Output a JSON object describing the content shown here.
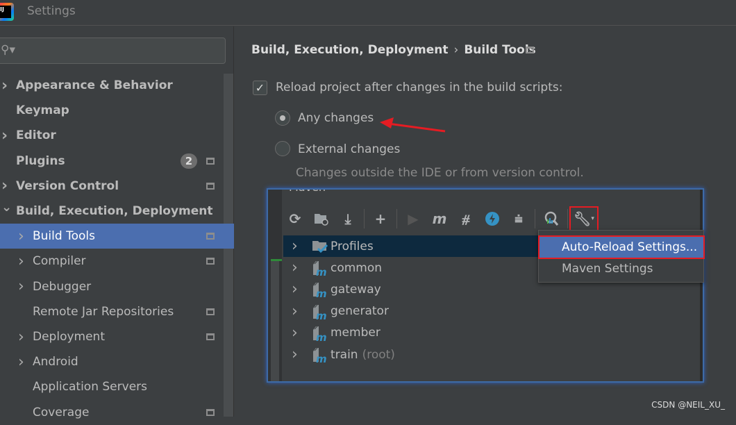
{
  "window": {
    "title": "Settings",
    "logo_text": "IJ"
  },
  "search": {
    "placeholder": ""
  },
  "sidebar": {
    "items": [
      {
        "label": "Appearance & Behavior",
        "expandable": true,
        "bold": true
      },
      {
        "label": "Keymap",
        "bold": true
      },
      {
        "label": "Editor",
        "expandable": true,
        "bold": true
      },
      {
        "label": "Plugins",
        "bold": true,
        "badge": "2"
      },
      {
        "label": "Version Control",
        "expandable": true,
        "bold": true
      },
      {
        "label": "Build, Execution, Deployment",
        "expanded": true,
        "bold": true
      },
      {
        "label": "Build Tools",
        "expandable": true,
        "selected": true
      },
      {
        "label": "Compiler",
        "expandable": true
      },
      {
        "label": "Debugger",
        "expandable": true
      },
      {
        "label": "Remote Jar Repositories"
      },
      {
        "label": "Deployment",
        "expandable": true
      },
      {
        "label": "Android",
        "expandable": true
      },
      {
        "label": "Application Servers"
      },
      {
        "label": "Coverage"
      }
    ]
  },
  "breadcrumb": {
    "parent": "Build, Execution, Deployment",
    "separator": "›",
    "current": "Build Tools"
  },
  "settings": {
    "reload_checkbox": {
      "label": "Reload project after changes in the build scripts:",
      "checked": true
    },
    "radio_any": {
      "label": "Any changes",
      "selected": true
    },
    "radio_external": {
      "label": "External changes",
      "selected": false
    },
    "external_hint": "Changes outside the IDE or from version control."
  },
  "maven": {
    "title": "Maven",
    "toolbar": [
      "refresh-icon",
      "folder-refresh-icon",
      "download-icon",
      "add-icon",
      "run-icon",
      "maven-goal-icon",
      "toggle-offline-icon",
      "lightning-icon",
      "collapse-icon",
      "analyze-icon",
      "wrench-icon"
    ],
    "tree": [
      {
        "name": "Profiles",
        "icon": "profiles-icon",
        "highlighted": true
      },
      {
        "name": "common"
      },
      {
        "name": "gateway"
      },
      {
        "name": "generator"
      },
      {
        "name": "member"
      },
      {
        "name": "train",
        "suffix": "(root)"
      }
    ],
    "menu": [
      {
        "label": "Auto-Reload Settings...",
        "active": true
      },
      {
        "label": "Maven Settings"
      }
    ]
  },
  "colors": {
    "accent": "#4b6eaf",
    "highlight_box": "#e51c23",
    "arrow": "#e51c23",
    "maven_blue": "#3592c4"
  },
  "watermark": "CSDN @NEIL_XU_"
}
